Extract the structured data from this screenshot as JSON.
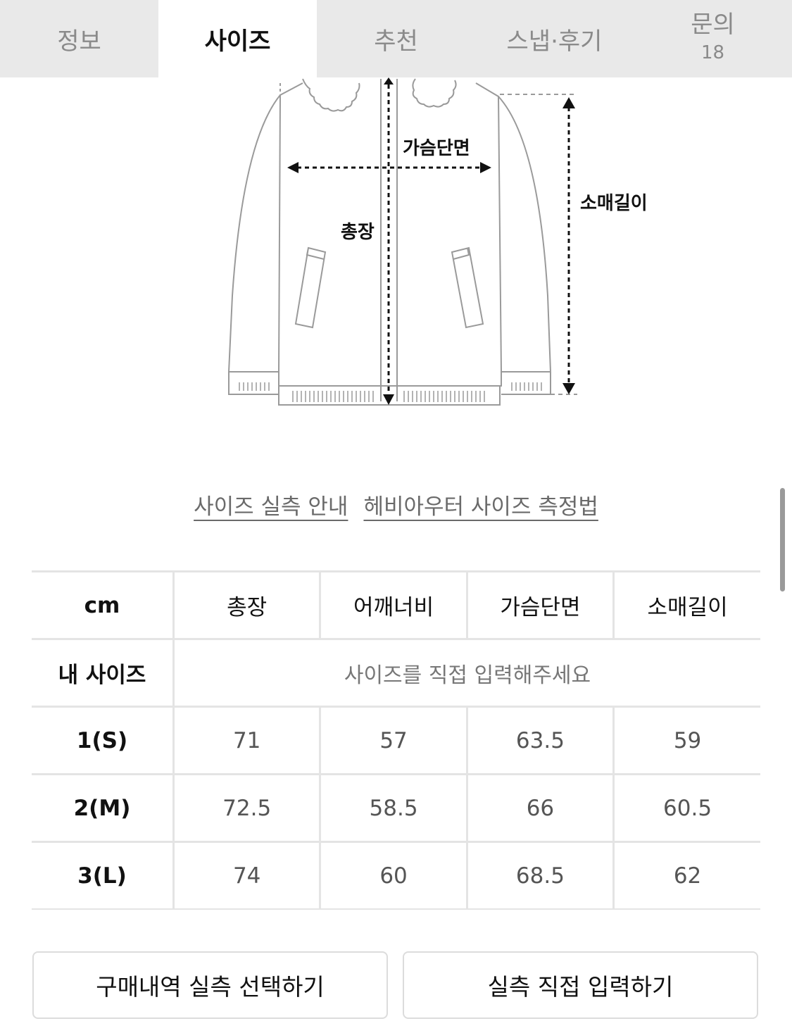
{
  "tabs": [
    {
      "label": "정보",
      "active": false
    },
    {
      "label": "사이즈",
      "active": true
    },
    {
      "label": "추천",
      "active": false
    },
    {
      "label": "스냅·후기",
      "active": false
    },
    {
      "label": "문의",
      "count": "18",
      "active": false
    }
  ],
  "diagram": {
    "chest_label": "가슴단면",
    "length_label": "총장",
    "sleeve_label": "소매길이"
  },
  "links": {
    "size_guide": "사이즈 실측 안내",
    "measure_method": "헤비아우터 사이즈 측정법"
  },
  "table": {
    "unit": "cm",
    "headers": [
      "총장",
      "어깨너비",
      "가슴단면",
      "소매길이"
    ],
    "my_size_label": "내 사이즈",
    "my_size_placeholder": "사이즈를 직접 입력해주세요",
    "rows": [
      {
        "size": "1(S)",
        "values": [
          "71",
          "57",
          "63.5",
          "59"
        ]
      },
      {
        "size": "2(M)",
        "values": [
          "72.5",
          "58.5",
          "66",
          "60.5"
        ]
      },
      {
        "size": "3(L)",
        "values": [
          "74",
          "60",
          "68.5",
          "62"
        ]
      }
    ]
  },
  "buttons": {
    "select_from_purchase": "구매내역 실측 선택하기",
    "enter_directly": "실측 직접 입력하기"
  }
}
